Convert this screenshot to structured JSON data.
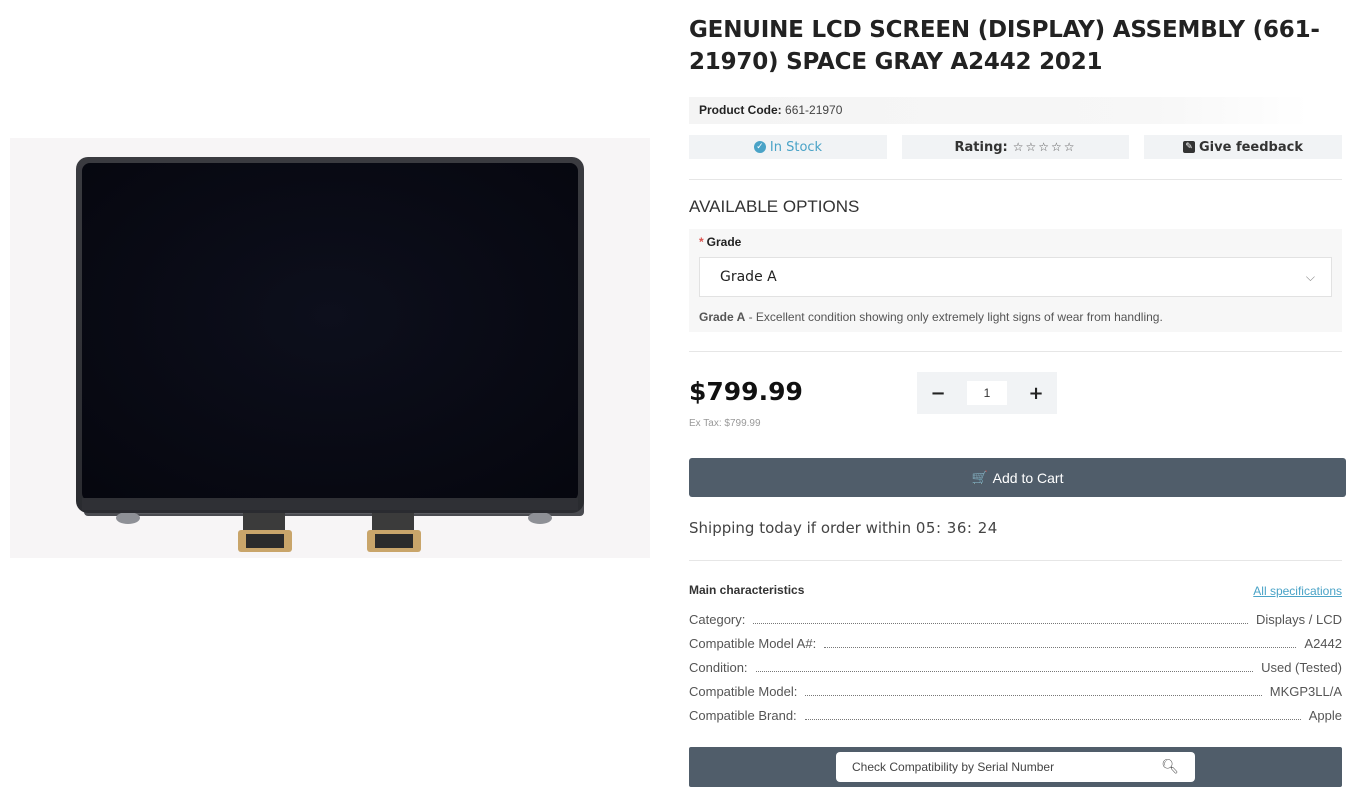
{
  "product": {
    "title": "GENUINE LCD SCREEN (DISPLAY) ASSEMBLY (661-21970) SPACE GRAY A2442 2021",
    "code_label": "Product Code:",
    "code_value": "661-21970",
    "image_alt": "LCD screen assembly product photo"
  },
  "status": {
    "stock": "In Stock",
    "rating_label": "Rating:",
    "rating_stars": "☆☆☆☆☆",
    "rating_value": 0,
    "feedback": "Give feedback"
  },
  "options": {
    "title": "AVAILABLE OPTIONS",
    "grade_label": "Grade",
    "required_mark": "*",
    "selected": "Grade A",
    "desc_bold": "Grade A",
    "desc_text": " - Excellent condition showing only extremely light signs of wear from handling."
  },
  "pricing": {
    "price": "$799.99",
    "ex_tax": "Ex Tax: $799.99",
    "qty": "1",
    "minus": "−",
    "plus": "+"
  },
  "cart": {
    "label": "Add to Cart",
    "icon": "basket-icon"
  },
  "shipping": {
    "text": "Shipping today if order within ",
    "timer": "05: 36: 24"
  },
  "characteristics": {
    "title": "Main characteristics",
    "all_link": "All specifications",
    "rows": [
      {
        "key": "Category:",
        "value": "Displays / LCD"
      },
      {
        "key": "Compatible Model A#:",
        "value": "A2442"
      },
      {
        "key": "Condition:",
        "value": "Used (Tested)"
      },
      {
        "key": "Compatible Model:",
        "value": "MKGP3LL/A"
      },
      {
        "key": "Compatible Brand:",
        "value": "Apple"
      }
    ]
  },
  "compat": {
    "placeholder": "Check Compatibility by Serial Number",
    "icon": "search-icon"
  },
  "colors": {
    "accent": "#4aa3c7",
    "button_dark": "#505d6a",
    "required": "#d9534f"
  }
}
